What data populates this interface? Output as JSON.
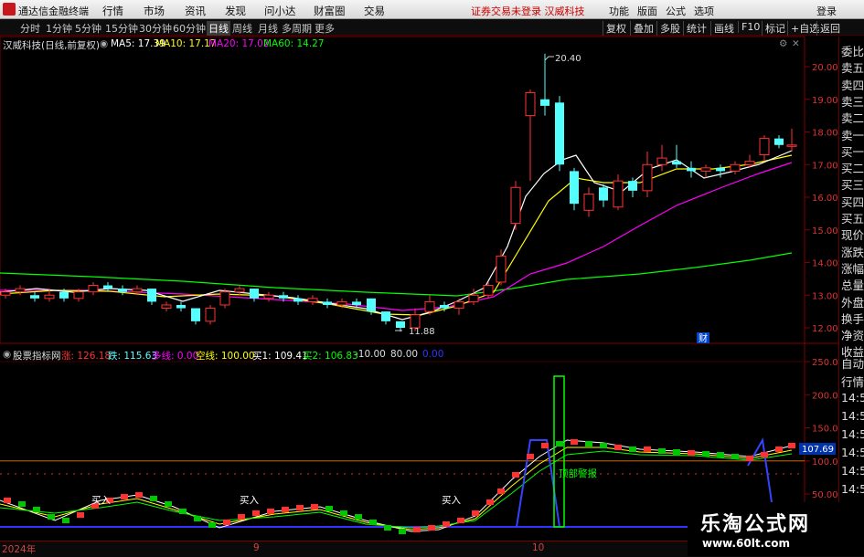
{
  "app": {
    "name": "通达信金融终端"
  },
  "menu": [
    "行情",
    "市场",
    "资讯",
    "发现",
    "问小达",
    "财富圈",
    "交易"
  ],
  "warning": "证券交易未登录 汉威科技",
  "right_menu": [
    "功能",
    "版面",
    "公式",
    "选项",
    "登录"
  ],
  "periods": [
    "分时",
    "1分钟",
    "5分钟",
    "15分钟",
    "30分钟",
    "60分钟",
    "日线",
    "周线",
    "月线",
    "多周期",
    "更多"
  ],
  "active_period": "日线",
  "right_buttons": [
    "复权",
    "叠加",
    "多股",
    "统计",
    "画线",
    "F10",
    "标记",
    "+自选",
    "返回"
  ],
  "main_header": {
    "stock": "汉威科技(日线,前复权)",
    "ma5": "MA5: 17.39",
    "ma10": "MA10: 17.17",
    "ma20": "MA20: 17.02",
    "ma60": "MA60: 14.27"
  },
  "price_axis": [
    "20.00",
    "19.00",
    "18.00",
    "17.00",
    "16.00",
    "15.00",
    "14.00",
    "13.00",
    "12.00"
  ],
  "annotations": {
    "high": "20.40",
    "low": "11.88",
    "fin_marker": "财"
  },
  "sub_header": {
    "title": "股票指标网",
    "up": "涨: 126.18",
    "down": "跌: 115.63",
    "long": "多线: 0.00",
    "short": "空线: 100.00",
    "buy1": "买1: 109.41",
    "buy2": "买2: 106.83",
    "v1": "-10.00",
    "v2": "80.00",
    "v3": "0.00"
  },
  "sub_axis": [
    "250.00",
    "200.00",
    "150.00",
    "100.00",
    "50.00"
  ],
  "sub_current": "107.69",
  "sub_labels": {
    "buy": "买入",
    "top": "顶部警报"
  },
  "right_panel": [
    "委比",
    "卖五",
    "卖四",
    "卖三",
    "卖二",
    "卖一",
    "买一",
    "买二",
    "买三",
    "买四",
    "买五",
    "现价",
    "涨跌",
    "涨幅",
    "总量",
    "外盘",
    "换手",
    "净资",
    "收益"
  ],
  "right_panel2": [
    "自动",
    "行情",
    "14:5",
    "14:5",
    "14:5",
    "14:5",
    "14:5",
    "14:5",
    "14:5"
  ],
  "dates": [
    "2024年",
    "9",
    "10"
  ],
  "watermark": {
    "line1": "乐淘公式网",
    "line2": "www.60lt.com"
  },
  "colors": {
    "up": "#ff3232",
    "down": "#54ffff",
    "ma5": "#ffffff",
    "ma10": "#ffff00",
    "ma20": "#ff00ff",
    "ma60": "#00ff00"
  }
}
